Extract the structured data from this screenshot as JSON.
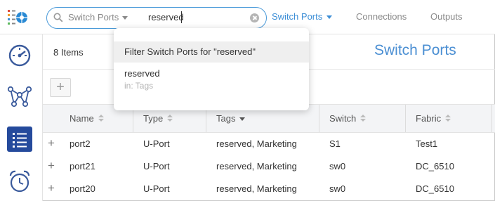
{
  "search": {
    "scope_label": "Switch Ports",
    "query": "reserved"
  },
  "nav": {
    "active": "Switch Ports",
    "links": [
      "Connections",
      "Outputs"
    ]
  },
  "sidebar": {
    "items": [
      {
        "icon": "dashboard-gauge-icon"
      },
      {
        "icon": "topology-graph-icon"
      },
      {
        "icon": "list-icon",
        "active": true
      },
      {
        "icon": "alarm-clock-icon"
      }
    ]
  },
  "main": {
    "item_count": "8 Items",
    "page_title": "Switch Ports",
    "add_label": "+"
  },
  "table": {
    "columns": [
      "Name",
      "Type",
      "Tags",
      "Switch",
      "Fabric"
    ],
    "sorted_column": "Tags",
    "rows": [
      {
        "name": "port2",
        "type": "U-Port",
        "tags": "reserved, Marketing",
        "switch": "S1",
        "fabric": "Test1"
      },
      {
        "name": "port21",
        "type": "U-Port",
        "tags": "reserved, Marketing",
        "switch": "sw0",
        "fabric": "DC_6510"
      },
      {
        "name": "port20",
        "type": "U-Port",
        "tags": "reserved, Marketing",
        "switch": "sw0",
        "fabric": "DC_6510"
      }
    ],
    "expand_label": "+"
  },
  "dropdown": {
    "filter_text": "Filter Switch Ports for \"reserved\"",
    "suggestion_value": "reserved",
    "suggestion_context": "in: Tags"
  },
  "colors": {
    "accent": "#3c8ed6",
    "sidebar_active": "#254a9c",
    "title": "#4b8fd3"
  }
}
